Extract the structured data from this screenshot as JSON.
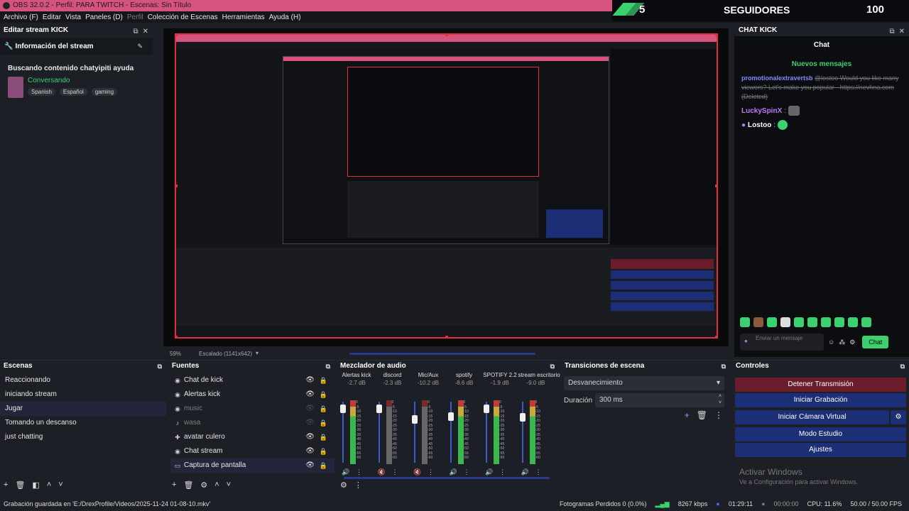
{
  "window": {
    "title": "OBS 32.0.2 - Perfil: PARA TWITCH - Escenas: Sin Título"
  },
  "menu": {
    "items": [
      "Archivo (F)",
      "Editar",
      "Vista",
      "Paneles (D)",
      "Perfil",
      "Colección de Escenas",
      "Herramientas",
      "Ayuda (H)"
    ]
  },
  "overlay": {
    "left_count": "5",
    "label": "SEGUIDORES",
    "right_count": "100"
  },
  "edit_dock": {
    "title": "Editar stream KICK",
    "section": "Información del stream",
    "stream_title": "Buscando contenido chatyipiti ayuda",
    "category": "Conversando",
    "tags": [
      "Spanish",
      "Español",
      "gaming"
    ]
  },
  "chat_dock": {
    "title": "CHAT KICK",
    "heading": "Chat",
    "new_messages": "Nuevos mensajes",
    "messages": [
      {
        "user": "promotionalextravertsb",
        "text": "@lostoo Would you like many viewers? Let's make you popular - https://nevhna.com (Deleted)"
      },
      {
        "user": "LuckySpinX",
        "text": ""
      },
      {
        "user": "Lostoo",
        "text": ""
      }
    ],
    "input_placeholder": "Enviar un mensaje",
    "send_label": "Chat"
  },
  "scalebar": {
    "zoom": "59%",
    "scaling": "Escalado (1141x642)"
  },
  "scenes": {
    "title": "Escenas",
    "items": [
      "Reaccionando",
      "iniciando stream",
      "Jugar",
      "Tomando un descanso",
      "just chatting"
    ],
    "selected": "Jugar"
  },
  "sources": {
    "title": "Fuentes",
    "items": [
      {
        "name": "Chat de kick",
        "icon": "globe-icon",
        "visible": true
      },
      {
        "name": "Alertas kick",
        "icon": "globe-icon",
        "visible": true
      },
      {
        "name": "music",
        "icon": "globe-icon",
        "visible": false
      },
      {
        "name": "wasa",
        "icon": "audio-icon",
        "visible": false
      },
      {
        "name": "avatar culero",
        "icon": "gamepad-icon",
        "visible": true
      },
      {
        "name": "Chat stream",
        "icon": "globe-icon",
        "visible": true
      },
      {
        "name": "Captura de pantalla",
        "icon": "monitor-icon",
        "visible": true
      }
    ]
  },
  "mixer": {
    "title": "Mezclador de audio",
    "channels": [
      {
        "name": "Alertas kick",
        "db": "-2.7 dB",
        "muted": false,
        "level": 0.95
      },
      {
        "name": "discord",
        "db": "-2.3 dB",
        "muted": true,
        "level": 0.95
      },
      {
        "name": "Mic/Aux",
        "db": "-10.2 dB",
        "muted": true,
        "level": 0.75
      },
      {
        "name": "spotify",
        "db": "-8.6 dB",
        "muted": false,
        "level": 0.8
      },
      {
        "name": "SPOTIFY 2.2",
        "db": "-1.9 dB",
        "muted": false,
        "level": 0.95
      },
      {
        "name": "stream escritorio",
        "db": "-9.0 dB",
        "muted": false,
        "level": 0.78
      }
    ],
    "scale": [
      "0",
      "-5",
      "-10",
      "-15",
      "-20",
      "-25",
      "-30",
      "-35",
      "-40",
      "-45",
      "-50",
      "-55",
      "-60"
    ]
  },
  "transitions": {
    "title": "Transiciones de escena",
    "selected": "Desvanecimiento",
    "duration_label": "Duración",
    "duration_value": "300 ms"
  },
  "controls": {
    "title": "Controles",
    "stop_stream": "Detener Transmisión",
    "start_recording": "Iniciar Grabación",
    "start_virtual_cam": "Iniciar Cámara Virtual",
    "studio_mode": "Modo Estudio",
    "settings": "Ajustes",
    "watermark_title": "Activar Windows",
    "watermark_text": "Ve a Configuración para activar Windows."
  },
  "status": {
    "message": "Grabación guardada en 'E:/DrexProfile/Videos/2025-11-24 01-08-10.mkv'",
    "dropped_frames": "Fotogramas Perdidos 0 (0.0%)",
    "bitrate": "8267 kbps",
    "stream_time": "01:29:11",
    "rec_time": "00:00:00",
    "cpu": "CPU: 11.6%",
    "fps": "50.00 / 50.00 FPS"
  },
  "colors": {
    "accent": "#d6537e",
    "record_red": "#e0303e",
    "blue_btn": "#1c2e75",
    "stop_btn": "#6b1c2a",
    "kick_green": "#3bd16f"
  }
}
